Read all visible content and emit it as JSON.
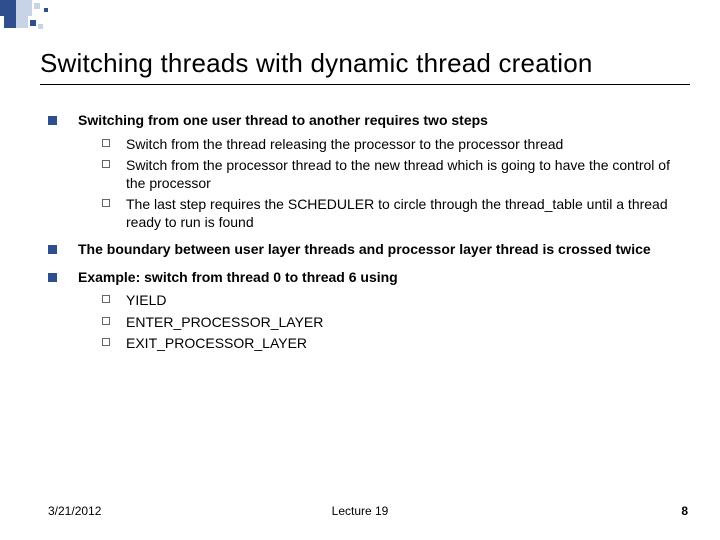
{
  "title": "Switching threads with dynamic thread creation",
  "bullets": [
    {
      "text": "Switching from one user thread to another requires two steps",
      "sub": [
        "Switch from the thread releasing the processor  to the processor thread",
        "Switch from the processor thread to the new thread which is going to have the control of the processor",
        "The last step requires the SCHEDULER to circle through the thread_table until a thread ready to run is found"
      ]
    },
    {
      "text": "The boundary between user layer threads and processor layer thread is crossed twice",
      "sub": []
    },
    {
      "text": "Example: switch from thread 0 to thread 6 using",
      "sub": [
        "YIELD",
        "ENTER_PROCESSOR_LAYER",
        "EXIT_PROCESSOR_LAYER"
      ]
    }
  ],
  "footer": {
    "date": "3/21/2012",
    "center": "Lecture 19",
    "page": "8"
  }
}
